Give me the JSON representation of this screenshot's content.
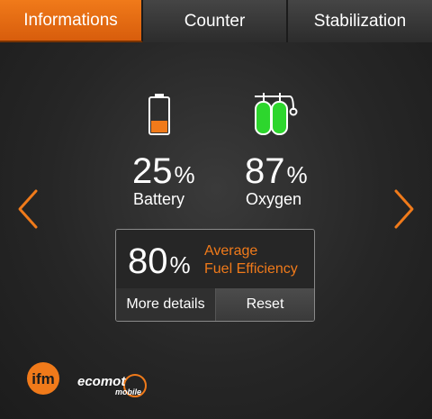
{
  "tabs": [
    {
      "label": "Informations",
      "active": true
    },
    {
      "label": "Counter",
      "active": false
    },
    {
      "label": "Stabilization",
      "active": false
    }
  ],
  "battery": {
    "value": "25",
    "unit": "%",
    "label": "Battery",
    "level": 0.35,
    "fill_color": "#f07a1a"
  },
  "oxygen": {
    "value": "87",
    "unit": "%",
    "label": "Oxygen",
    "fill_color": "#2dd62d"
  },
  "fuel": {
    "value": "80",
    "unit": "%",
    "label_line1": "Average",
    "label_line2": "Fuel Efficiency"
  },
  "buttons": {
    "details": "More details",
    "reset": "Reset"
  },
  "icons": {
    "left": "chevron-left-icon",
    "right": "chevron-right-icon",
    "battery": "battery-icon",
    "oxygen": "oxygen-tanks-icon"
  },
  "colors": {
    "accent": "#f07a1a",
    "oxygen": "#2dd62d",
    "background": "#262626"
  },
  "logos": {
    "brand": "ifm",
    "product": "ecomot",
    "product_sub": "mobile"
  }
}
